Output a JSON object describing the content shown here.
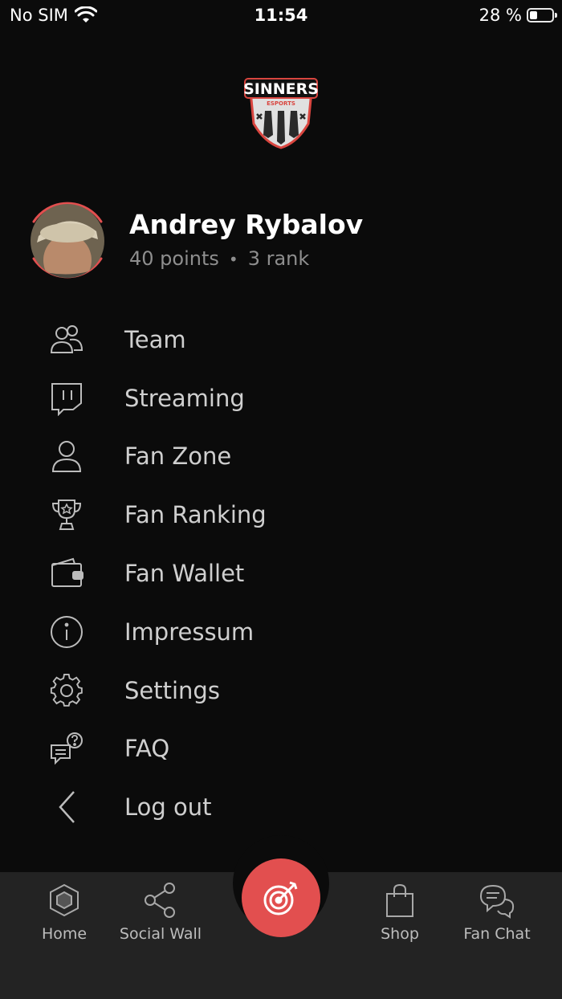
{
  "status_bar": {
    "carrier": "No SIM",
    "time": "11:54",
    "battery": "28 %",
    "battery_level": 0.28
  },
  "logo": {
    "text": "SINNERS",
    "subtext": "ESPORTS"
  },
  "profile": {
    "name": "Andrey Rybalov",
    "points": "40 points",
    "separator": "•",
    "rank": "3 rank"
  },
  "menu": [
    {
      "label": "Team",
      "icon": "team-icon"
    },
    {
      "label": "Streaming",
      "icon": "twitch-icon"
    },
    {
      "label": "Fan Zone",
      "icon": "user-icon"
    },
    {
      "label": "Fan Ranking",
      "icon": "trophy-icon"
    },
    {
      "label": "Fan Wallet",
      "icon": "wallet-icon"
    },
    {
      "label": "Impressum",
      "icon": "info-icon"
    },
    {
      "label": "Settings",
      "icon": "gear-icon"
    },
    {
      "label": "FAQ",
      "icon": "faq-icon"
    },
    {
      "label": "Log out",
      "icon": "chevron-left-icon"
    }
  ],
  "tabs": [
    {
      "label": "Home",
      "icon": "home-cube-icon"
    },
    {
      "label": "Social Wall",
      "icon": "share-icon"
    },
    {
      "label": "Shop",
      "icon": "shopping-bag-icon"
    },
    {
      "label": "Fan Chat",
      "icon": "chat-bubbles-icon"
    }
  ],
  "colors": {
    "accent": "#e24f4f",
    "background": "#0b0b0b",
    "tab_bar": "#232323",
    "menu_text": "#cfcfcf",
    "muted_text": "#8e8e8e"
  }
}
